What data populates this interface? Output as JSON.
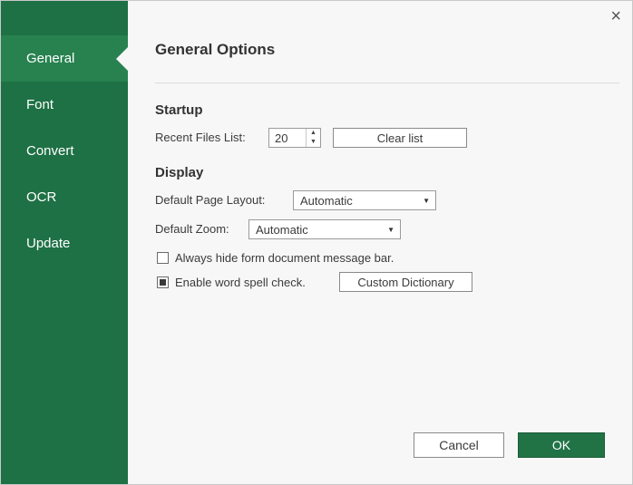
{
  "window": {
    "close_icon": "×"
  },
  "sidebar": {
    "items": [
      {
        "label": "General",
        "selected": true
      },
      {
        "label": "Font",
        "selected": false
      },
      {
        "label": "Convert",
        "selected": false
      },
      {
        "label": "OCR",
        "selected": false
      },
      {
        "label": "Update",
        "selected": false
      }
    ]
  },
  "header": {
    "title": "General Options"
  },
  "startup": {
    "heading": "Startup",
    "recent_files_label": "Recent Files List:",
    "recent_files_value": "20",
    "spinner_up_icon": "▲",
    "spinner_down_icon": "▼",
    "clear_list_button": "Clear list"
  },
  "display": {
    "heading": "Display",
    "page_layout_label": "Default Page Layout:",
    "page_layout_value": "Automatic",
    "zoom_label": "Default Zoom:",
    "zoom_value": "Automatic",
    "dropdown_arrow_icon": "▼",
    "hide_message_bar_label": "Always hide form document message bar.",
    "hide_message_bar_checked": false,
    "spell_check_label": "Enable word spell check.",
    "spell_check_checked": true,
    "custom_dictionary_button": "Custom Dictionary"
  },
  "footer": {
    "cancel_button": "Cancel",
    "ok_button": "OK"
  },
  "colors": {
    "sidebar_green": "#1e7145",
    "selected_item_green": "#27824f",
    "ok_button_green": "#217346",
    "panel_background": "#f7f7f7"
  }
}
